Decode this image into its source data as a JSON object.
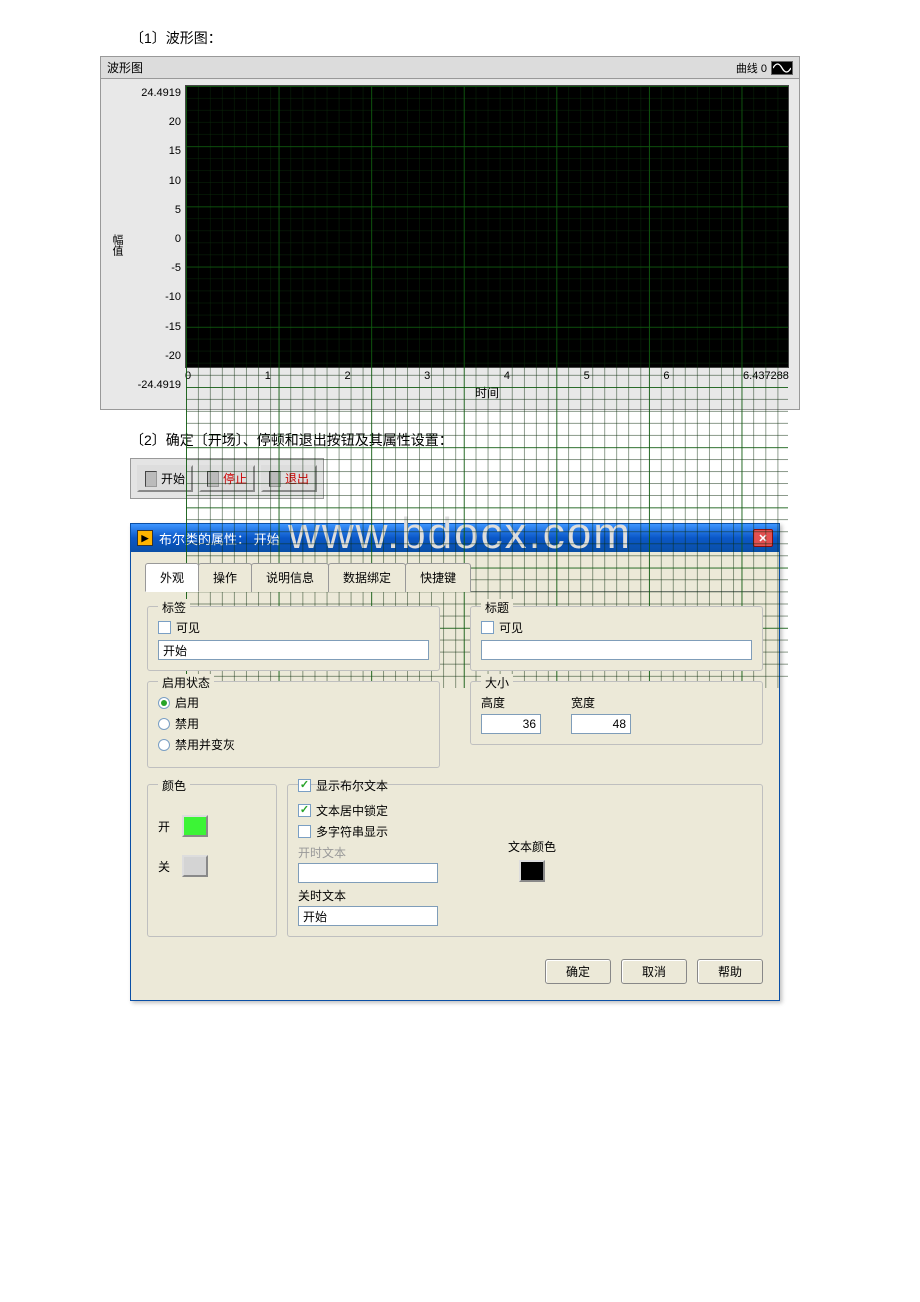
{
  "headings": {
    "h1": "〔1〕波形图：",
    "h2": "〔2〕确定〔开场〕、停顿和退出按钮及其属性设置："
  },
  "chart": {
    "title": "波形图",
    "legend": "曲线 0",
    "y_label": "幅值",
    "x_label": "时间",
    "y_ticks": [
      "24.4919",
      "20",
      "15",
      "10",
      "5",
      "0",
      "-5",
      "-10",
      "-15",
      "-20",
      "-24.4919"
    ],
    "x_ticks": [
      "0",
      "1",
      "2",
      "3",
      "4",
      "5",
      "6",
      "6.437288"
    ]
  },
  "chart_data": {
    "type": "line",
    "title": "波形图",
    "xlabel": "时间",
    "ylabel": "幅值",
    "xlim": [
      0,
      6.437288
    ],
    "ylim": [
      -24.4919,
      24.4919
    ],
    "series": [
      {
        "name": "曲线 0",
        "x": [],
        "y": []
      }
    ]
  },
  "buttons": {
    "start": "开始",
    "stop": "停止",
    "exit": "退出"
  },
  "watermark": "www.bdocx.com",
  "dialog": {
    "title": "布尔类的属性： 开始",
    "tabs": [
      "外观",
      "操作",
      "说明信息",
      "数据绑定",
      "快捷键"
    ],
    "label_group": {
      "title": "标签",
      "visible_label": "可见",
      "value": "开始"
    },
    "caption_group": {
      "title": "标题",
      "visible_label": "可见",
      "value": ""
    },
    "enable_group": {
      "title": "启用状态",
      "opt_enabled": "启用",
      "opt_disabled": "禁用",
      "opt_disabled_gray": "禁用并变灰"
    },
    "size_group": {
      "title": "大小",
      "height_label": "高度",
      "width_label": "宽度",
      "height": "36",
      "width": "48"
    },
    "color_group": {
      "title": "颜色",
      "on_label": "开",
      "off_label": "关"
    },
    "text_group": {
      "show_bool_text": "显示布尔文本",
      "center_lock": "文本居中锁定",
      "multi_string": "多字符串显示",
      "on_text_label": "开时文本",
      "on_text_value": "",
      "off_text_label": "关时文本",
      "off_text_value": "开始",
      "text_color_label": "文本颜色"
    },
    "ok": "确定",
    "cancel": "取消",
    "help": "帮助"
  }
}
